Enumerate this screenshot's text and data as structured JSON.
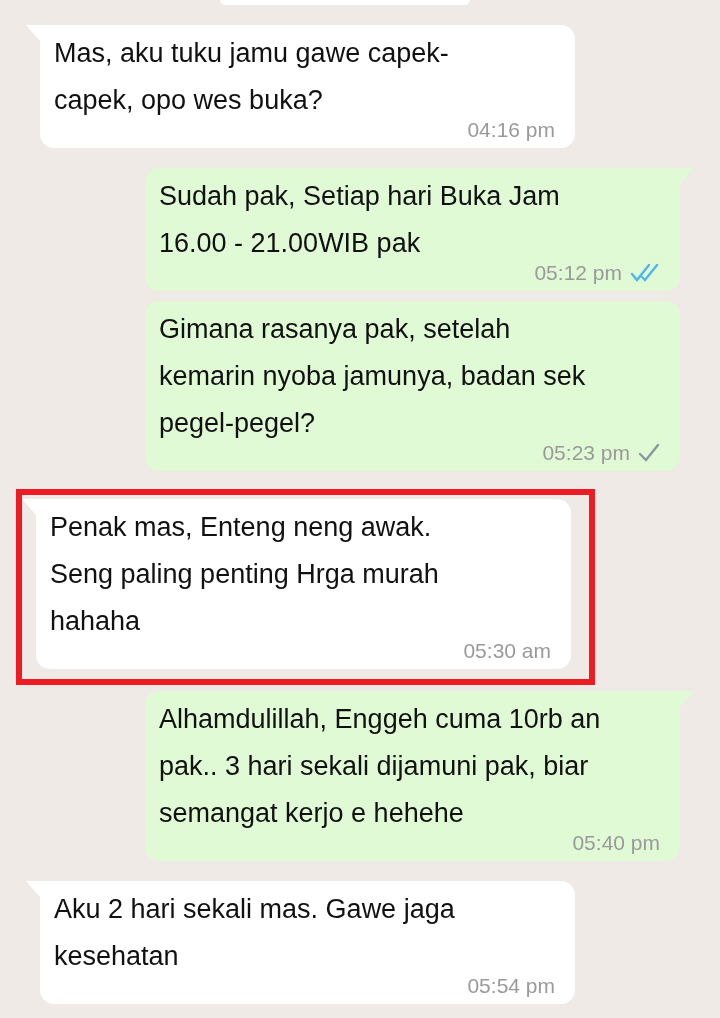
{
  "messages": [
    {
      "outgoing": false,
      "tail": true,
      "highlighted": false,
      "text": "Mas, aku tuku jamu gawe capek-\ncapek, opo wes buka?",
      "time": "04:16 pm",
      "sent": false,
      "read": false
    },
    {
      "outgoing": true,
      "tail": true,
      "highlighted": false,
      "text": "Sudah pak, Setiap hari Buka Jam\n16.00 - 21.00WIB pak",
      "time": "05:12 pm",
      "sent": true,
      "read": true
    },
    {
      "outgoing": true,
      "tail": false,
      "highlighted": false,
      "text": "Gimana rasanya pak, setelah\nkemarin nyoba jamunya, badan sek\npegel-pegel?",
      "time": "05:23 pm",
      "sent": true,
      "read": false
    },
    {
      "outgoing": false,
      "tail": true,
      "highlighted": true,
      "text": "Penak mas, Enteng neng awak.\nSeng paling penting Hrga murah\nhahaha",
      "time": "05:30 am",
      "sent": false,
      "read": false
    },
    {
      "outgoing": true,
      "tail": true,
      "highlighted": false,
      "text": "Alhamdulillah, Enggeh cuma 10rb an\npak.. 3 hari sekali dijamuni pak, biar\nsemangat kerjo e  hehehe",
      "time": "05:40 pm",
      "sent": false,
      "read": false
    },
    {
      "outgoing": false,
      "tail": true,
      "highlighted": false,
      "text": "Aku 2 hari sekali mas. Gawe jaga\nkesehatan",
      "time": "05:54 pm",
      "sent": false,
      "read": false
    }
  ]
}
